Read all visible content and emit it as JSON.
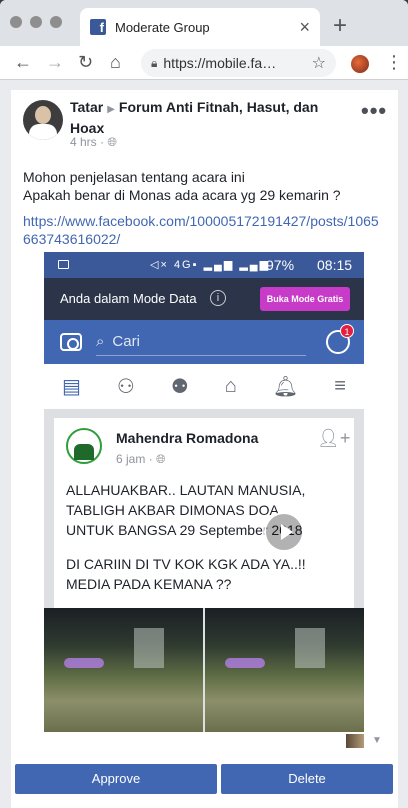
{
  "browser": {
    "tab_title": "Moderate Group",
    "url": "https://mobile.fa…",
    "tab_close": "×",
    "new_tab": "+"
  },
  "post": {
    "author": "Tatar",
    "group": "Forum Anti Fitnah, Hasut, dan Hoax",
    "time": "4 hrs",
    "text_line1": "Mohon penjelasan tentang acara ini",
    "text_line2": "Apakah benar di Monas ada acara yg 29 kemarin ?",
    "link": "https://www.facebook.com/100005172191427/posts/1065663743616022/"
  },
  "screenshot": {
    "battery": "97%",
    "time": "08:15",
    "data_mode_text": "Anda dalam Mode Data",
    "data_mode_button": "Buka Mode Gratis",
    "search_placeholder": "Cari",
    "notification_count": "1",
    "card": {
      "name": "Mahendra Romadona",
      "time": "6 jam",
      "text_line1": "ALLAHUAKBAR.. LAUTAN MANUSIA,",
      "text_line2": "TABLIGH AKBAR DIMONAS DOA",
      "text_line3": "UNTUK BANGSA 29 September 2018",
      "text_line4": "DI CARIIN DI TV KOK KGK ADA YA..!!",
      "text_line5": "MEDIA PADA KEMANA ??"
    }
  },
  "actions": {
    "approve": "Approve",
    "delete": "Delete"
  }
}
